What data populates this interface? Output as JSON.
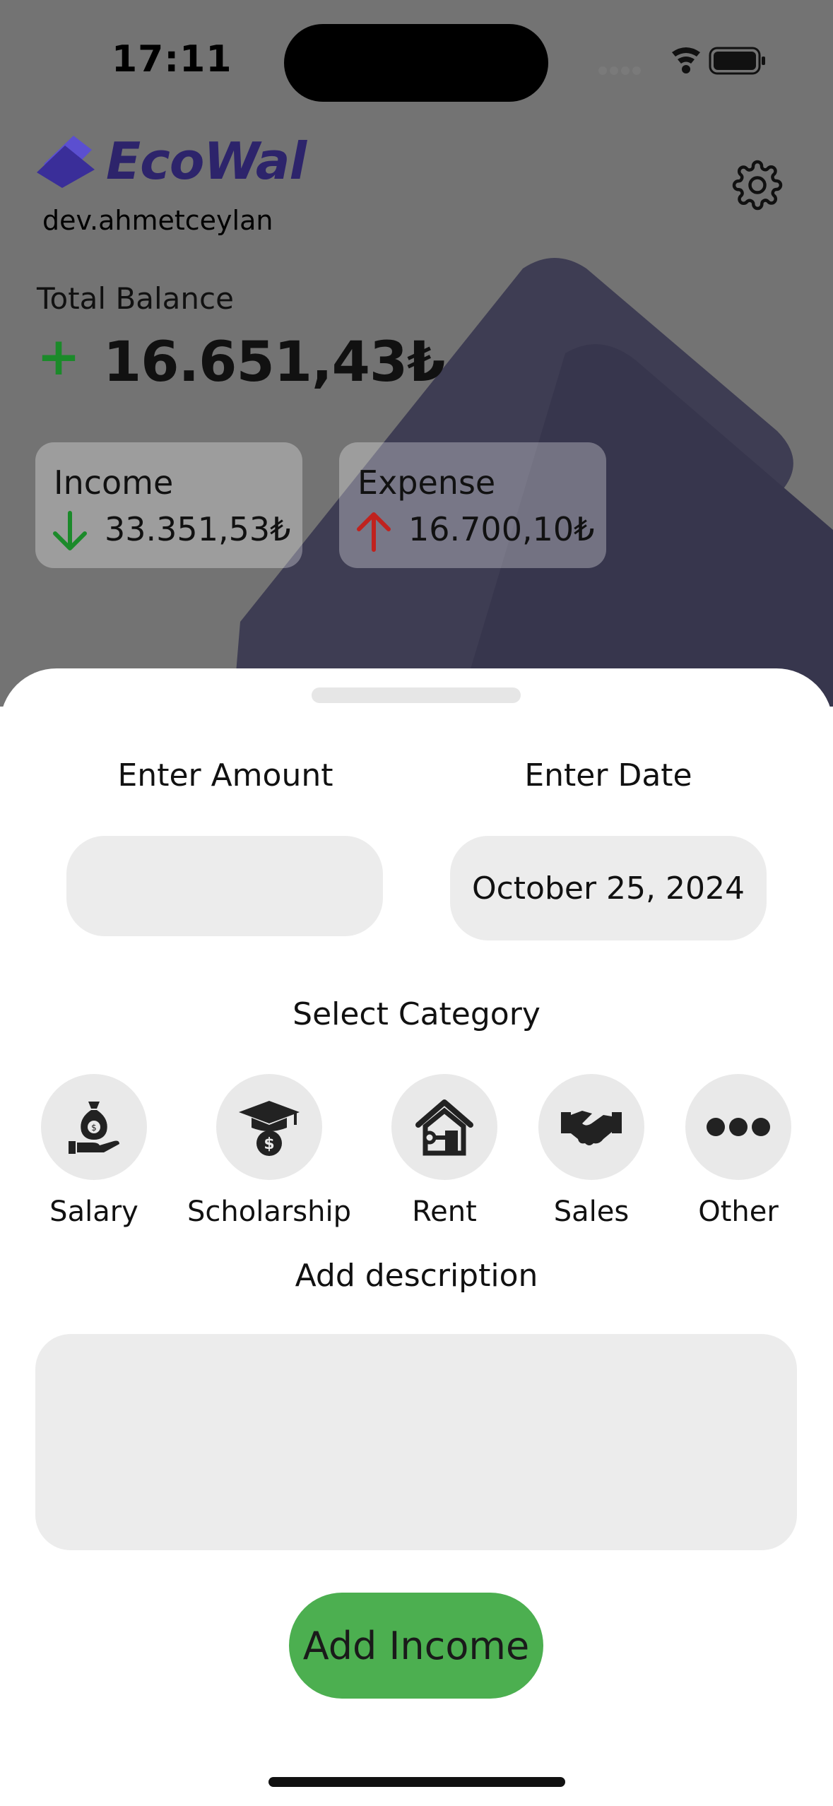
{
  "status_bar": {
    "time": "17:11"
  },
  "header": {
    "brand": "EcoWal",
    "username": "dev.ahmetceylan",
    "settings_icon": "gear-icon"
  },
  "balance": {
    "label": "Total Balance",
    "sign": "+",
    "value": "16.651,43₺"
  },
  "income_card": {
    "title": "Income",
    "value": "33.351,53₺",
    "arrow_color": "#1b8a2a"
  },
  "expense_card": {
    "title": "Expense",
    "value": "16.700,10₺",
    "arrow_color": "#c0221e"
  },
  "sheet": {
    "amount_label": "Enter Amount",
    "amount_value": "",
    "date_label": "Enter Date",
    "date_value": "October 25, 2024",
    "category_title": "Select Category",
    "categories": [
      {
        "label": "Salary",
        "icon": "money-bag-hand-icon"
      },
      {
        "label": "Scholarship",
        "icon": "graduation-cap-coin-icon"
      },
      {
        "label": "Rent",
        "icon": "house-key-icon"
      },
      {
        "label": "Sales",
        "icon": "handshake-icon"
      },
      {
        "label": "Other",
        "icon": "more-dots-icon"
      }
    ],
    "description_title": "Add description",
    "description_value": "",
    "submit_label": "Add Income",
    "submit_color": "#4caf50"
  }
}
